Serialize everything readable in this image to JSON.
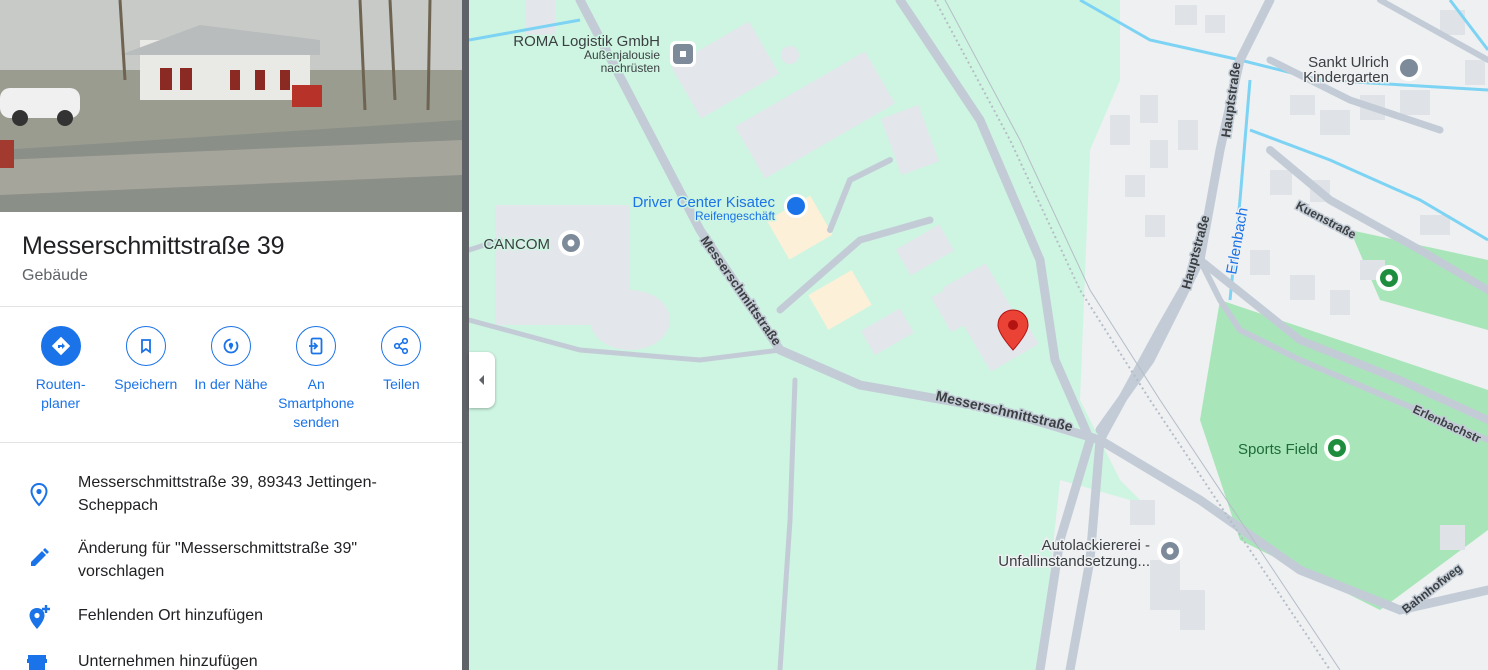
{
  "place": {
    "title": "Messerschmittstraße 39",
    "subtitle": "Gebäude"
  },
  "actions": [
    {
      "label": "Routen-\nplaner",
      "icon": "directions-icon"
    },
    {
      "label": "Speichern",
      "icon": "bookmark-icon"
    },
    {
      "label": "In der Nähe",
      "icon": "nearby-icon"
    },
    {
      "label": "An\nSmartphone\nsenden",
      "icon": "send-to-phone-icon"
    },
    {
      "label": "Teilen",
      "icon": "share-icon"
    }
  ],
  "info": [
    {
      "text": "Messerschmittstraße 39, 89343 Jettingen-Scheppach",
      "icon": "location-pin-icon"
    },
    {
      "text": "Änderung für \"Messerschmittstraße 39\" vorschlagen",
      "icon": "edit-pencil-icon"
    },
    {
      "text": "Fehlenden Ort hinzufügen",
      "icon": "add-place-icon"
    },
    {
      "text": "Unternehmen hinzufügen",
      "icon": "add-business-icon"
    }
  ],
  "map": {
    "pois": {
      "roma": "ROMA Logistik GmbH",
      "roma_sub1": "Außenjalousie",
      "roma_sub2": "nachrüsten",
      "driver": "Driver Center Kisatec",
      "driver_sub": "Reifengeschäft",
      "cancom": "CANCOM",
      "sankt1": "Sankt Ulrich",
      "sankt2": "Kindergarten",
      "sports": "Sports Field",
      "auto1": "Autolackiererei -",
      "auto2": "Unfallinstandsetzung..."
    },
    "streets": {
      "messer1": "Messerschmittstraße",
      "messer2": "Messerschmittstraße",
      "haupt1": "Hauptstraße",
      "haupt2": "Hauptstraße",
      "erlenbach": "Erlenbach",
      "kuen": "Kuenstraße",
      "erlenbachstr": "Erlenbachstr",
      "bahnhof": "Bahnhofweg"
    },
    "colors": {
      "green": "#cef5e2",
      "road": "#c3ccd6",
      "water": "#7dd3f3",
      "marker": "#ea4335",
      "accent": "#1a73e8"
    }
  }
}
